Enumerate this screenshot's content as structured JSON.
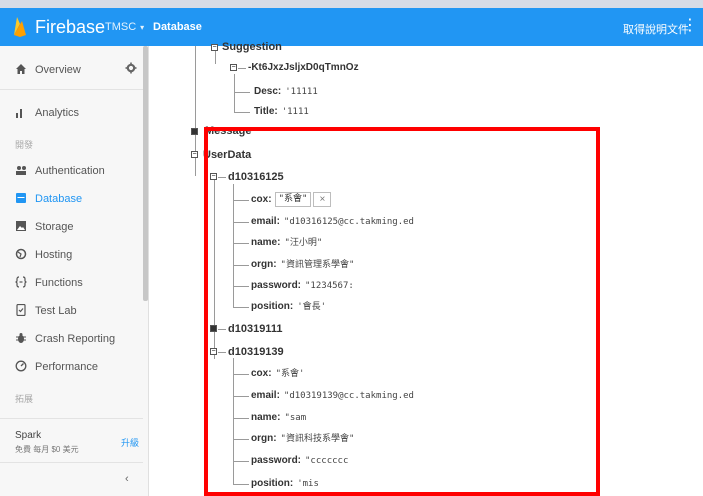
{
  "topbar": {
    "brand": "Firebase",
    "project": "TMSC",
    "project_caret": "▾",
    "section": "Database",
    "docs_link": "取得說明文件",
    "menu_icon": "more-vert-icon"
  },
  "sidebar": {
    "overview": "Overview",
    "settings_icon": "gear-icon",
    "items": [
      {
        "label": "Analytics",
        "icon": "bar-chart-icon"
      },
      {
        "label": "Authentication",
        "icon": "people-icon"
      },
      {
        "label": "Database",
        "icon": "database-icon"
      },
      {
        "label": "Storage",
        "icon": "image-icon"
      },
      {
        "label": "Hosting",
        "icon": "globe-icon"
      },
      {
        "label": "Functions",
        "icon": "braces-icon"
      },
      {
        "label": "Test Lab",
        "icon": "phone-check-icon"
      },
      {
        "label": "Crash Reporting",
        "icon": "bug-icon"
      },
      {
        "label": "Performance",
        "icon": "speedometer-icon"
      }
    ],
    "section_develop": "開發",
    "section_grow": "拓展",
    "plan_name": "Spark",
    "plan_desc": "免費 每月 $0 美元",
    "upgrade": "升級",
    "collapse": "‹"
  },
  "tree": {
    "suggestion": "Suggestion",
    "suggestion_id": "-Kt6JxzJsljxD0qTmnOz",
    "s_desc_key": "Desc:",
    "s_desc_val": "'11111",
    "s_title_key": "Title:",
    "s_title_val": "'1111",
    "message": "Message",
    "userdata": "UserData",
    "user1": "d10316125",
    "u1_cox_key": "cox:",
    "u1_cox_val": "\"系會\"",
    "u1_email_key": "email:",
    "u1_email_val": "\"d10316125@cc.takming.ed",
    "u1_name_key": "name:",
    "u1_name_val": "\"汪小明\"",
    "u1_orgn_key": "orgn:",
    "u1_orgn_val": "\"資訊管理系學會\"",
    "u1_password_key": "password:",
    "u1_password_val": "\"1234567:",
    "u1_position_key": "position:",
    "u1_position_val": "'會長'",
    "user2": "d10319111",
    "user3": "d10319139",
    "u3_cox_key": "cox:",
    "u3_cox_val": "\"系會'",
    "u3_email_key": "email:",
    "u3_email_val": "\"d10319139@cc.takming.ed",
    "u3_name_key": "name:",
    "u3_name_val": "\"sam",
    "u3_orgn_key": "orgn:",
    "u3_orgn_val": "\"資訊科技系學會\"",
    "u3_password_key": "password:",
    "u3_password_val": "\"ccccccc",
    "u3_position_key": "position:",
    "u3_position_val": "'mis",
    "edit_clear": "×"
  },
  "colors": {
    "accent": "#2196f3",
    "highlight": "#ff0000"
  }
}
